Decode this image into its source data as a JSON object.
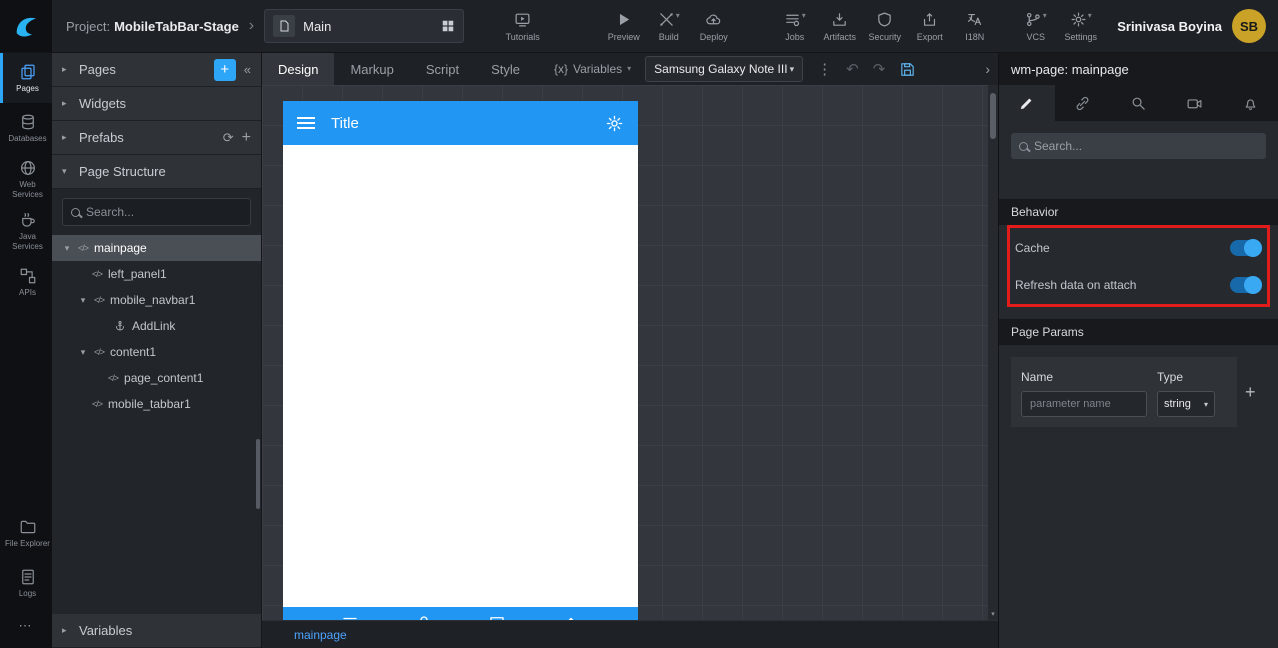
{
  "topbar": {
    "project_label": "Project:",
    "project_name": "MobileTabBar-Stage",
    "page_name": "Main",
    "actions": [
      {
        "label": "Tutorials",
        "caret": false
      },
      {
        "label": "Preview",
        "caret": false
      },
      {
        "label": "Build",
        "caret": true
      },
      {
        "label": "Deploy",
        "caret": false
      },
      {
        "label": "Jobs",
        "caret": true
      },
      {
        "label": "Artifacts",
        "caret": false
      },
      {
        "label": "Security",
        "caret": false
      },
      {
        "label": "Export",
        "caret": false
      },
      {
        "label": "I18N",
        "caret": false
      },
      {
        "label": "VCS",
        "caret": true
      },
      {
        "label": "Settings",
        "caret": true
      }
    ],
    "user": {
      "name": "Srinivasa Boyina",
      "initials": "SB"
    }
  },
  "rail": {
    "items": [
      {
        "label": "Pages"
      },
      {
        "label": "Databases"
      },
      {
        "label": "Web Services"
      },
      {
        "label": "Java Services"
      },
      {
        "label": "APIs"
      },
      {
        "label": "File Explorer"
      },
      {
        "label": "Logs"
      }
    ]
  },
  "explorer": {
    "sections": {
      "pages": "Pages",
      "widgets": "Widgets",
      "prefabs": "Prefabs",
      "page_structure": "Page Structure",
      "variables": "Variables"
    },
    "search_placeholder": "Search...",
    "tree": [
      {
        "label": "mainpage"
      },
      {
        "label": "left_panel1"
      },
      {
        "label": "mobile_navbar1"
      },
      {
        "label": "AddLink"
      },
      {
        "label": "content1"
      },
      {
        "label": "page_content1"
      },
      {
        "label": "mobile_tabbar1"
      }
    ]
  },
  "editor": {
    "tabs": [
      {
        "label": "Design"
      },
      {
        "label": "Markup"
      },
      {
        "label": "Script"
      },
      {
        "label": "Style"
      }
    ],
    "active_tab": "Design",
    "variables_prefix": "{x}",
    "variables_label": "Variables",
    "device": "Samsung Galaxy Note III",
    "bottom_tab": "mainpage"
  },
  "phone": {
    "title": "Title"
  },
  "props": {
    "title": "wm-page: mainpage",
    "search_placeholder": "Search...",
    "behavior": {
      "heading": "Behavior",
      "rows": [
        {
          "label": "Cache",
          "state": "on"
        },
        {
          "label": "Refresh data on attach",
          "state": "on"
        }
      ]
    },
    "page_params": {
      "heading": "Page Params",
      "name_header": "Name",
      "type_header": "Type",
      "param_placeholder": "parameter name",
      "type_value": "string"
    }
  },
  "glyphs": {
    "caret_down": "▾",
    "caret_right": "▸",
    "chevron_right": "›",
    "collapse_left": "«",
    "plus": "+",
    "refresh": "⟳",
    "dots_vertical": "⋮",
    "dots_horizontal": "⋯",
    "undo": "↶",
    "redo": "↷",
    "code": "</>"
  },
  "colors": {
    "accent": "#2196f3",
    "highlight_box": "#e21b1b",
    "avatar": "#c9a227"
  }
}
